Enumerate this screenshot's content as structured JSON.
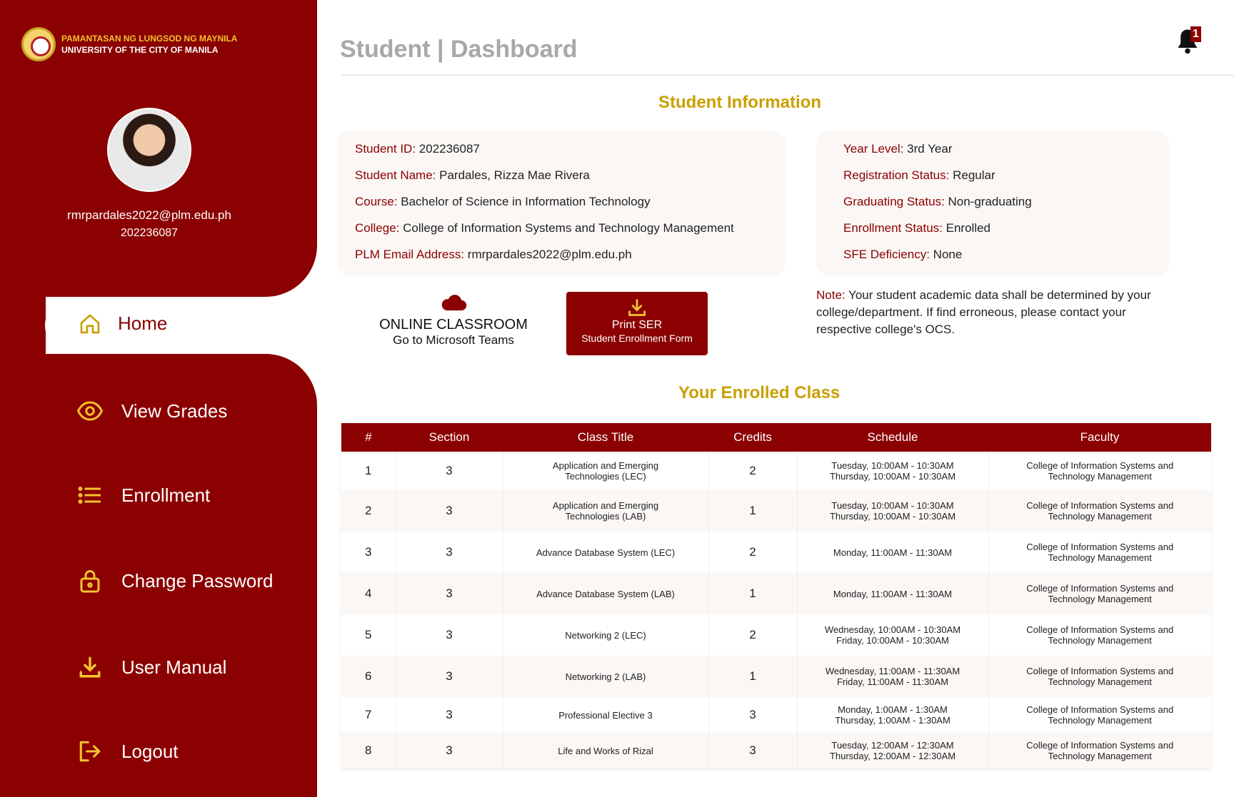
{
  "brand": {
    "line1": "PAMANTASAN NG LUNGSOD NG MAYNILA",
    "line2": "UNIVERSITY OF THE CITY OF MANILA"
  },
  "profile": {
    "email": "rmrpardales2022@plm.edu.ph",
    "id": "202236087"
  },
  "nav": {
    "home": "Home",
    "grades": "View Grades",
    "enrollment": "Enrollment",
    "password": "Change Password",
    "manual": "User Manual",
    "logout": "Logout"
  },
  "header": {
    "title": "Student | Dashboard",
    "notification_count": "1"
  },
  "student_info": {
    "title": "Student Information",
    "left": [
      {
        "label": "Student ID:",
        "value": " 202236087"
      },
      {
        "label": "Student Name:",
        "value": " Pardales, Rizza Mae Rivera"
      },
      {
        "label": "Course:",
        "value": " Bachelor of Science in Information Technology"
      },
      {
        "label": "College:",
        "value": " College of Information Systems and Technology Management"
      },
      {
        "label": "PLM Email Address:",
        "value": " rmrpardales2022@plm.edu.ph"
      }
    ],
    "right": [
      {
        "label": "Year Level:",
        "value": " 3rd Year"
      },
      {
        "label": "Registration Status:",
        "value": " Regular"
      },
      {
        "label": "Graduating Status:",
        "value": " Non-graduating"
      },
      {
        "label": "Enrollment Status:",
        "value": " Enrolled"
      },
      {
        "label": "SFE Deficiency:",
        "value": " None"
      }
    ]
  },
  "online_classroom": {
    "title": "ONLINE CLASSROOM",
    "subtitle": "Go to Microsoft Teams"
  },
  "print_button": {
    "line1": "Print SER",
    "line2": "Student Enrollment Form"
  },
  "note": {
    "label": "Note:",
    "text": " Your student academic data shall be determined by your college/department. If find erroneous, please contact your respective college's OCS."
  },
  "enrolled": {
    "title": "Your Enrolled Class",
    "headers": [
      "#",
      "Section",
      "Class Title",
      "Credits",
      "Schedule",
      "Faculty"
    ],
    "rows": [
      {
        "n": "1",
        "section": "3",
        "title": "Application and Emerging\nTechnologies (LEC)",
        "credits": "2",
        "schedule": "Tuesday, 10:00AM - 10:30AM\nThursday, 10:00AM - 10:30AM",
        "faculty": "College of Information Systems and\nTechnology Management"
      },
      {
        "n": "2",
        "section": "3",
        "title": "Application and Emerging\nTechnologies (LAB)",
        "credits": "1",
        "schedule": "Tuesday, 10:00AM - 10:30AM\nThursday, 10:00AM - 10:30AM",
        "faculty": "College of Information Systems and\nTechnology Management"
      },
      {
        "n": "3",
        "section": "3",
        "title": "Advance Database System (LEC)",
        "credits": "2",
        "schedule": "Monday, 11:00AM - 11:30AM",
        "faculty": "College of Information Systems and\nTechnology Management"
      },
      {
        "n": "4",
        "section": "3",
        "title": "Advance Database System (LAB)",
        "credits": "1",
        "schedule": "Monday, 11:00AM - 11:30AM",
        "faculty": "College of Information Systems and\nTechnology Management"
      },
      {
        "n": "5",
        "section": "3",
        "title": "Networking 2 (LEC)",
        "credits": "2",
        "schedule": "Wednesday, 10:00AM - 10:30AM\nFriday, 10:00AM - 10:30AM",
        "faculty": "College of Information Systems and\nTechnology Management"
      },
      {
        "n": "6",
        "section": "3",
        "title": "Networking 2 (LAB)",
        "credits": "1",
        "schedule": "Wednesday, 11:00AM - 11:30AM\nFriday, 11:00AM - 11:30AM",
        "faculty": "College of Information Systems and\nTechnology Management"
      },
      {
        "n": "7",
        "section": "3",
        "title": "Professional Elective 3",
        "credits": "3",
        "schedule": "Monday, 1:00AM - 1:30AM\nThursday, 1:00AM - 1:30AM",
        "faculty": "College of Information Systems and\nTechnology Management"
      },
      {
        "n": "8",
        "section": "3",
        "title": "Life and Works of Rizal",
        "credits": "3",
        "schedule": "Tuesday, 12:00AM - 12:30AM\nThursday, 12:00AM - 12:30AM",
        "faculty": "College of Information Systems and\nTechnology Management"
      }
    ]
  },
  "colors": {
    "maroon": "#8b0000",
    "gold": "#c9a000",
    "icon_gold": "#f2c230"
  }
}
